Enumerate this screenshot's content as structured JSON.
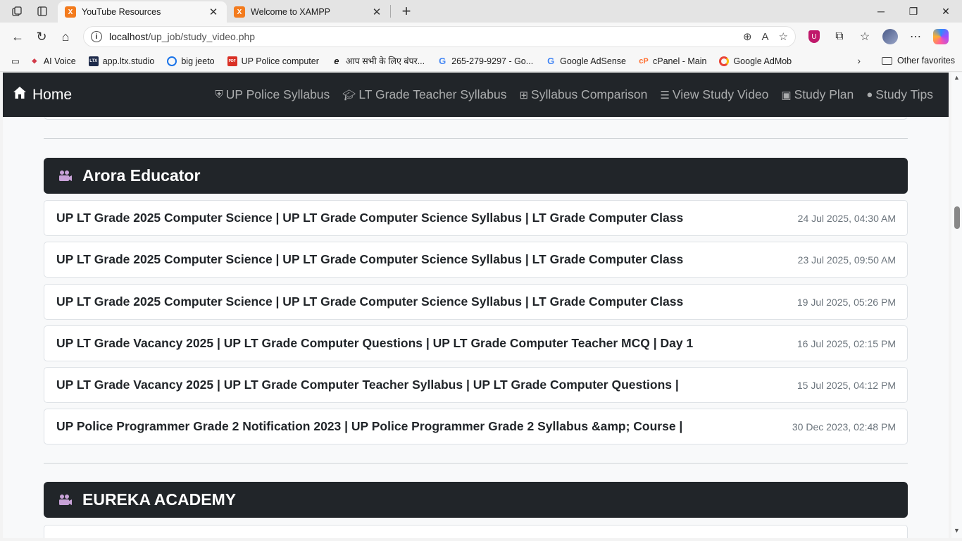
{
  "browser": {
    "tabs": [
      {
        "title": "YouTube Resources",
        "active": true
      },
      {
        "title": "Welcome to XAMPP",
        "active": false
      }
    ],
    "url_host": "localhost",
    "url_path": "/up_job/study_video.php",
    "bookmarks": [
      {
        "label": "AI Voice",
        "icon": "ai-voice-icon",
        "color": "#d23b4a"
      },
      {
        "label": "app.ltx.studio",
        "icon": "ltx-icon",
        "color": "#1d2a4a"
      },
      {
        "label": "big jeeto",
        "icon": "big-jeeto-icon",
        "color": "#1a73e8"
      },
      {
        "label": "UP Police computer",
        "icon": "pdf-icon",
        "color": "#d93025"
      },
      {
        "label": "आप सभी के लिए बंपर...",
        "icon": "edge-e-icon",
        "color": "#333333"
      },
      {
        "label": "265-279-9297 - Go...",
        "icon": "google-icon",
        "color": "#4285f4"
      },
      {
        "label": "Google AdSense",
        "icon": "google-icon",
        "color": "#4285f4"
      },
      {
        "label": "cPanel - Main",
        "icon": "cpanel-icon",
        "color": "#ff6c2c"
      },
      {
        "label": "Google AdMob",
        "icon": "admob-icon",
        "color": "#ea4335"
      }
    ],
    "other_favorites": "Other favorites"
  },
  "navbar": {
    "brand": "Home",
    "links": [
      {
        "label": "UP Police Syllabus",
        "icon": "shield-icon"
      },
      {
        "label": "LT Grade Teacher Syllabus",
        "icon": "graduation-cap-icon"
      },
      {
        "label": "Syllabus Comparison",
        "icon": "grid-icon"
      },
      {
        "label": "View Study Video",
        "icon": "list-icon"
      },
      {
        "label": "Study Plan",
        "icon": "calendar-icon"
      },
      {
        "label": "Study Tips",
        "icon": "lightbulb-icon"
      }
    ]
  },
  "channels": [
    {
      "name": "Arora Educator",
      "icon": "video-camera-icon",
      "videos": [
        {
          "title": "UP LT Grade 2025 Computer Science | UP LT Grade Computer Science Syllabus | LT Grade Computer Class",
          "date": "24 Jul 2025, 04:30 AM"
        },
        {
          "title": "UP LT Grade 2025 Computer Science | UP LT Grade Computer Science Syllabus | LT Grade Computer Class",
          "date": "23 Jul 2025, 09:50 AM"
        },
        {
          "title": "UP LT Grade 2025 Computer Science | UP LT Grade Computer Science Syllabus | LT Grade Computer Class",
          "date": "19 Jul 2025, 05:26 PM"
        },
        {
          "title": "UP LT Grade Vacancy 2025 | UP LT Grade Computer Questions | UP LT Grade Computer Teacher MCQ | Day 1",
          "date": "16 Jul 2025, 02:15 PM"
        },
        {
          "title": "UP LT Grade Vacancy 2025 | UP LT Grade Computer Teacher Syllabus | UP LT Grade Computer Questions |",
          "date": "15 Jul 2025, 04:12 PM"
        },
        {
          "title": "UP Police Programmer Grade 2 Notification 2023 | UP Police Programmer Grade 2 Syllabus &amp; Course |",
          "date": "30 Dec 2023, 02:48 PM"
        }
      ]
    },
    {
      "name": "EUREKA ACADEMY",
      "icon": "video-camera-icon",
      "videos": []
    }
  ]
}
